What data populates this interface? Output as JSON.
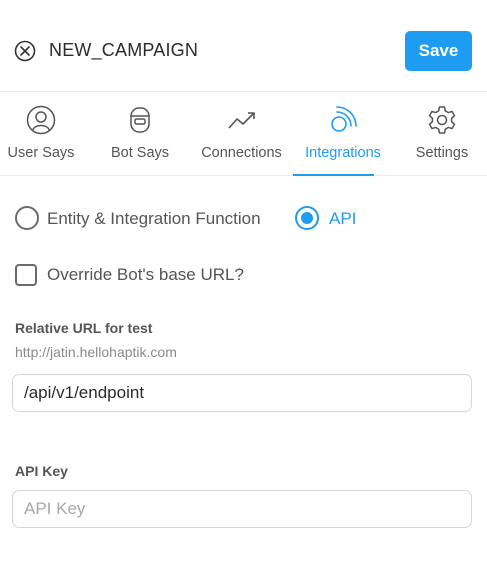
{
  "header": {
    "title": "NEW_CAMPAIGN",
    "save_label": "Save",
    "close_icon": "close-circle-icon"
  },
  "tabs": [
    {
      "label": "User Says",
      "icon": "user-avatar-icon",
      "active": false
    },
    {
      "label": "Bot Says",
      "icon": "robot-icon",
      "active": false
    },
    {
      "label": "Connections",
      "icon": "trending-up-icon",
      "active": false
    },
    {
      "label": "Integrations",
      "icon": "signal-icon",
      "active": true
    },
    {
      "label": "Settings",
      "icon": "gear-icon",
      "active": false
    }
  ],
  "integration_type": {
    "options": [
      {
        "label": "Entity & Integration Function",
        "selected": false
      },
      {
        "label": "API",
        "selected": true
      }
    ]
  },
  "override": {
    "label": "Override Bot's base URL?",
    "checked": false
  },
  "relative_url": {
    "label": "Relative URL for test",
    "hint": "http://jatin.hellohaptik.com",
    "value": "/api/v1/endpoint"
  },
  "api_key": {
    "label": "API Key",
    "placeholder": "API Key",
    "value": ""
  },
  "colors": {
    "accent": "#1e9cf1",
    "text": "#555555",
    "divider": "#ececec"
  }
}
